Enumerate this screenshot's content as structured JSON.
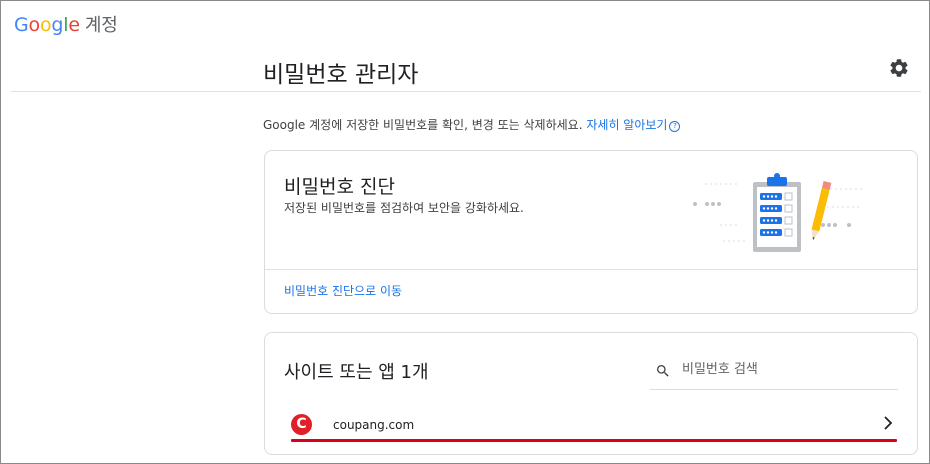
{
  "header": {
    "brand": "Google",
    "product": "계정"
  },
  "page": {
    "title": "비밀번호 관리자",
    "intro_text": "Google 계정에 저장한 비밀번호를 확인, 변경 또는 삭제하세요.",
    "learn_more": "자세히 알아보기"
  },
  "checkup_card": {
    "title": "비밀번호 진단",
    "description": "저장된 비밀번호를 점검하여 보안을 강화하세요.",
    "link": "비밀번호 진단으로 이동"
  },
  "sites_card": {
    "title": "사이트 또는 앱 1개",
    "search_placeholder": "비밀번호 검색",
    "items": [
      {
        "favicon_letter": "C",
        "domain": "coupang.com"
      }
    ]
  },
  "colors": {
    "link": "#1a73e8",
    "highlight": "#d9001b",
    "favicon": "#e01f26"
  },
  "icons": [
    "settings-gear-icon",
    "help-icon",
    "search-icon",
    "chevron-right-icon",
    "clipboard-illustration"
  ]
}
